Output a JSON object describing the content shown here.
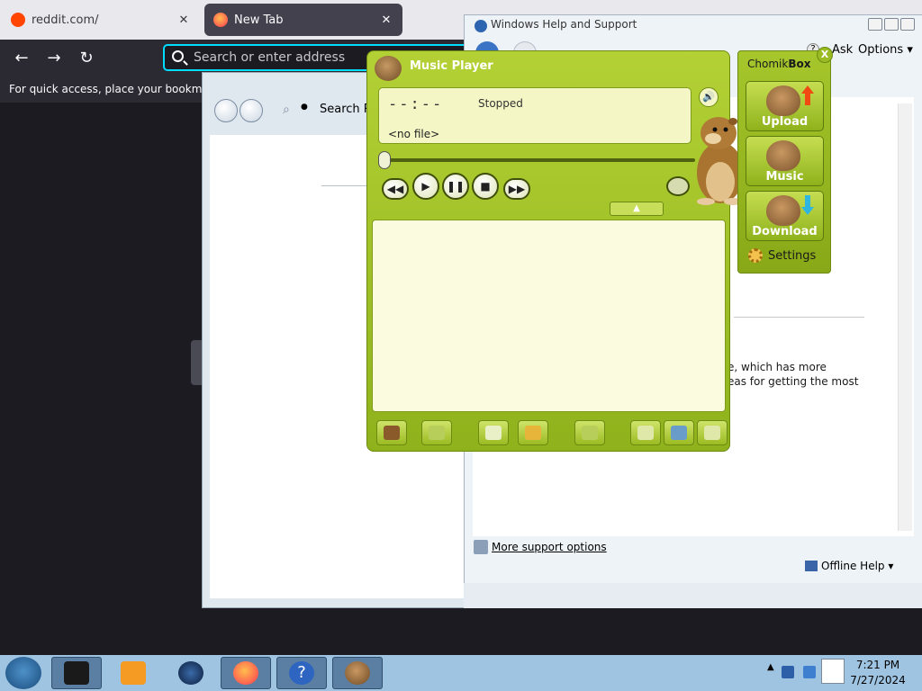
{
  "browser": {
    "tabs": [
      {
        "label": "reddit.com/",
        "favicon": "reddit-icon",
        "color": "#ff4500"
      },
      {
        "label": "New Tab",
        "favicon": "firefox-icon",
        "color": "#ff7139"
      }
    ],
    "url_placeholder": "Search or enter address",
    "bookmarks_hint": "For quick access, place your bookmarks here on the bookmarks toolbar."
  },
  "help_window": {
    "search_label": "Search R"
  },
  "whs_window": {
    "title": "Windows Help and Support",
    "ask_label": "Ask",
    "options_label": "Options",
    "content_text_1": "e, which has more",
    "content_text_2": "eas for getting the most",
    "more_support": "More support options",
    "offline_help": "Offline Help"
  },
  "music_player": {
    "title": "Music Player",
    "time": "--:--",
    "status": "Stopped",
    "file": "<no file>",
    "accent_color": "#9bbb22",
    "controls": [
      "rewind-button",
      "play-button",
      "pause-button",
      "stop-button",
      "fast-forward-button"
    ]
  },
  "chomikbox": {
    "title_plain": "Chomik",
    "title_bold": "Box",
    "close": "X",
    "upload": "Upload",
    "music": "Music",
    "download": "Download",
    "settings": "Settings"
  },
  "taskbar": {
    "time": "7:21 PM",
    "date": "7/27/2024",
    "color": "#9fc4e2"
  }
}
